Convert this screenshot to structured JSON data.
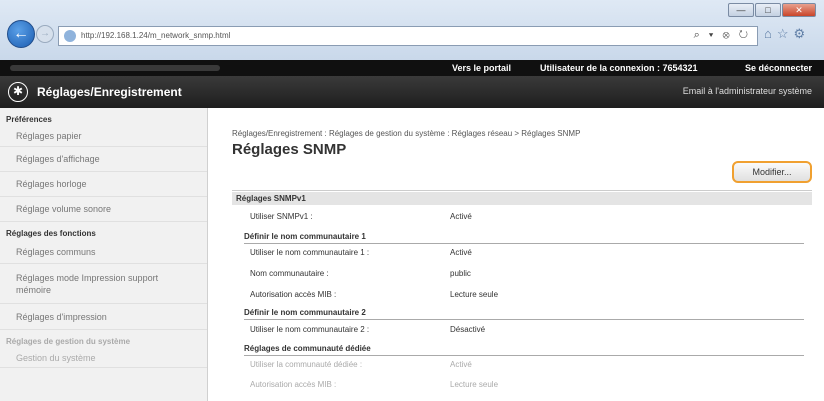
{
  "browser": {
    "url": "http://192.168.1.24/m_network_snmp.html",
    "tools": "⌕ ▾ ⊗ ↻"
  },
  "topbar": {
    "portal": "Vers le portail",
    "user_label": "Utilisateur de la connexion : 7654321",
    "logout": "Se déconnecter"
  },
  "header": {
    "title": "Réglages/Enregistrement",
    "email_admin": "Email à l'administrateur système"
  },
  "sidebar": {
    "sections": [
      {
        "title": "Préférences",
        "items": [
          "Réglages papier",
          "Réglages d'affichage",
          "Réglages horloge",
          "Réglage volume sonore"
        ]
      },
      {
        "title": "Réglages des fonctions",
        "items": [
          "Réglages communs",
          "Réglages mode Impression support mémoire",
          "Réglages d'impression"
        ]
      },
      {
        "title": "Réglages de gestion du système",
        "items": [
          "Gestion du système"
        ]
      }
    ]
  },
  "main": {
    "breadcrumb": "Réglages/Enregistrement : Réglages de gestion du système : Réglages réseau > Réglages SNMP",
    "title": "Réglages SNMP",
    "modify_button": "Modifier...",
    "section_v1": "Réglages SNMPv1",
    "use_snmpv1_label": "Utiliser SNMPv1 :",
    "use_snmpv1_value": "Activé",
    "community1_title": "Définir le nom communautaire 1",
    "community1_use_label": "Utiliser le nom communautaire 1 :",
    "community1_use_value": "Activé",
    "community_name_label": "Nom communautaire :",
    "community_name_value": "public",
    "mib_access_label": "Autorisation accès MIB :",
    "mib_access_value": "Lecture seule",
    "community2_title": "Définir le nom communautaire 2",
    "community2_use_label": "Utiliser le nom communautaire 2 :",
    "community2_use_value": "Désactivé",
    "dedicated_title": "Réglages de communauté dédiée",
    "dedicated_use_label": "Utiliser la communauté dédiée :",
    "dedicated_use_value": "Activé",
    "dedicated_mib_label": "Autorisation accès MIB :",
    "dedicated_mib_value": "Lecture seule"
  },
  "colors": {
    "highlight": "#f0a030",
    "header_bg": "#1e1e1e"
  }
}
